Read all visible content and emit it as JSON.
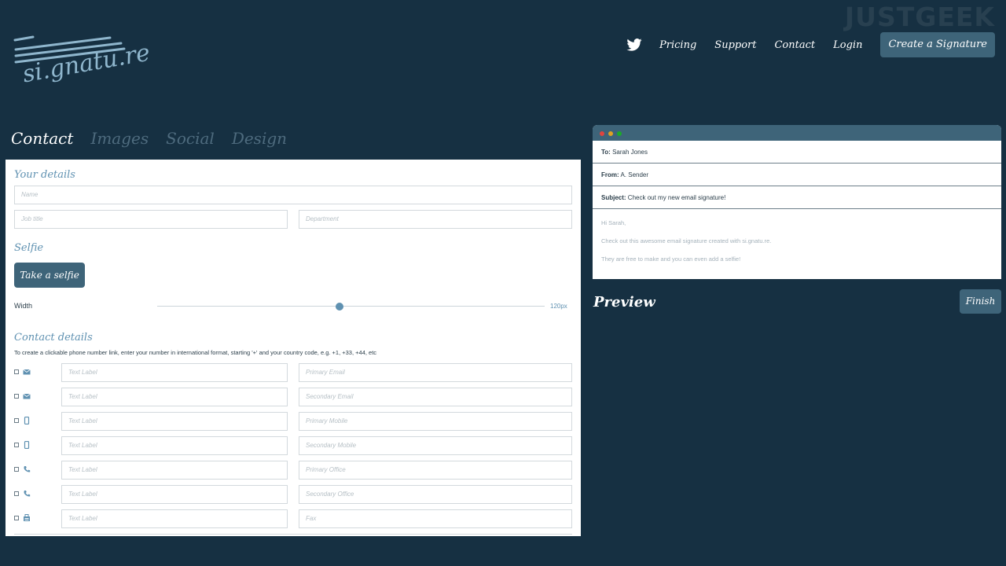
{
  "watermark": "JUSTGEEK",
  "logo": {
    "text": "si.gnatu.re"
  },
  "nav": {
    "twitter_icon": "twitter-icon",
    "links": [
      "Pricing",
      "Support",
      "Contact",
      "Login"
    ],
    "cta": "Create a Signature"
  },
  "tabs": [
    "Contact",
    "Images",
    "Social",
    "Design"
  ],
  "form": {
    "your_details_title": "Your details",
    "name_placeholder": "Name",
    "job_placeholder": "Job title",
    "department_placeholder": "Department",
    "selfie_title": "Selfie",
    "selfie_button": "Take a selfie",
    "width_label": "Width",
    "width_value": "120px",
    "width_slider_fraction": 0.47,
    "contact_details_title": "Contact details",
    "contact_help": "To create a clickable phone number link, enter your number in international format, starting '+' and your country code, e.g. +1, +33, +44, etc",
    "rows": [
      {
        "icon": "envelope-icon",
        "label_placeholder": "Text Label",
        "value_placeholder": "Primary Email"
      },
      {
        "icon": "envelope-icon",
        "label_placeholder": "Text Label",
        "value_placeholder": "Secondary Email"
      },
      {
        "icon": "mobile-icon",
        "label_placeholder": "Text Label",
        "value_placeholder": "Primary Mobile"
      },
      {
        "icon": "mobile-icon",
        "label_placeholder": "Text Label",
        "value_placeholder": "Secondary Mobile"
      },
      {
        "icon": "phone-icon",
        "label_placeholder": "Text Label",
        "value_placeholder": "Primary Office"
      },
      {
        "icon": "phone-icon",
        "label_placeholder": "Text Label",
        "value_placeholder": "Secondary Office"
      },
      {
        "icon": "fax-icon",
        "label_placeholder": "Text Label",
        "value_placeholder": "Fax"
      }
    ]
  },
  "email": {
    "to_label": "To:",
    "to": "Sarah Jones",
    "from_label": "From:",
    "from": "A. Sender",
    "subject_label": "Subject:",
    "subject": "Check out my new email signature!",
    "body": [
      "Hi Sarah,",
      "Check out this awesome email signature created with si.gnatu.re.",
      "They are free to make and you can even add a selfie!"
    ]
  },
  "preview_title": "Preview",
  "finish_button": "Finish",
  "colors": {
    "background": "#163042",
    "accent": "#3e6479",
    "heading_blue": "#5f91b1",
    "dot_red": "#e0443e",
    "dot_yellow": "#dea123",
    "dot_green": "#1aab29"
  }
}
